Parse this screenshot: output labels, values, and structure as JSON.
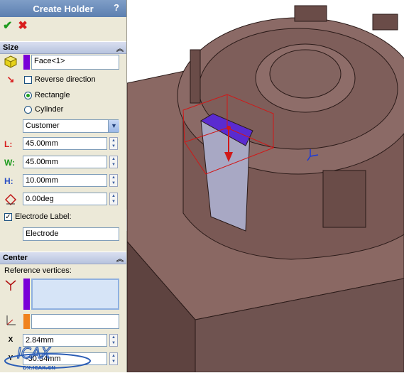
{
  "panel": {
    "title": "Create Holder",
    "help": "?",
    "ok": "✔",
    "cancel": "✖"
  },
  "size": {
    "header": "Size",
    "face_value": "Face<1>",
    "reverse_direction": "Reverse direction",
    "rectangle": "Rectangle",
    "cylinder": "Cylinder",
    "type_selected": "Customer",
    "L_label": "L:",
    "L": "45.00mm",
    "W_label": "W:",
    "W": "45.00mm",
    "H_label": "H:",
    "H": "10.00mm",
    "angle": "0.00deg",
    "electrode_label": "Electrode Label:",
    "electrode_value": "Electrode"
  },
  "center": {
    "header": "Center",
    "reference_vertices": "Reference vertices:",
    "x_value": "2.84mm",
    "y_value": "-30.34mm"
  },
  "colors": {
    "face_selection": "#7a00d8",
    "orange_selection": "#f0821e",
    "model": "#7e5b57",
    "highlight": "#5a2bd0"
  }
}
